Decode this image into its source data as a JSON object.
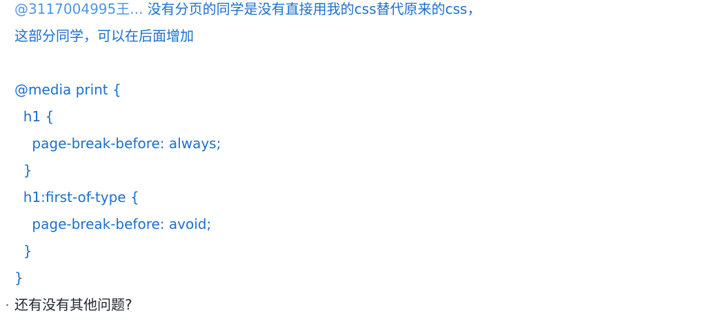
{
  "message": {
    "mention": "@3117004995王...",
    "line1_rest": " 没有分页的同学是没有直接用我的css替代原来的css，",
    "line2": "这部分同学，可以在后面增加",
    "code": [
      "@media print {",
      "  h1 {",
      "    page-break-before: always;",
      "  }",
      "  h1:first-of-type {",
      "    page-break-before: avoid;",
      "  }",
      "}"
    ]
  },
  "followup": {
    "text": "还有没有其他问题?"
  },
  "colors": {
    "mention": "#4b96e6",
    "message_text": "#1a6fcf",
    "plain_text": "#1f2430"
  }
}
